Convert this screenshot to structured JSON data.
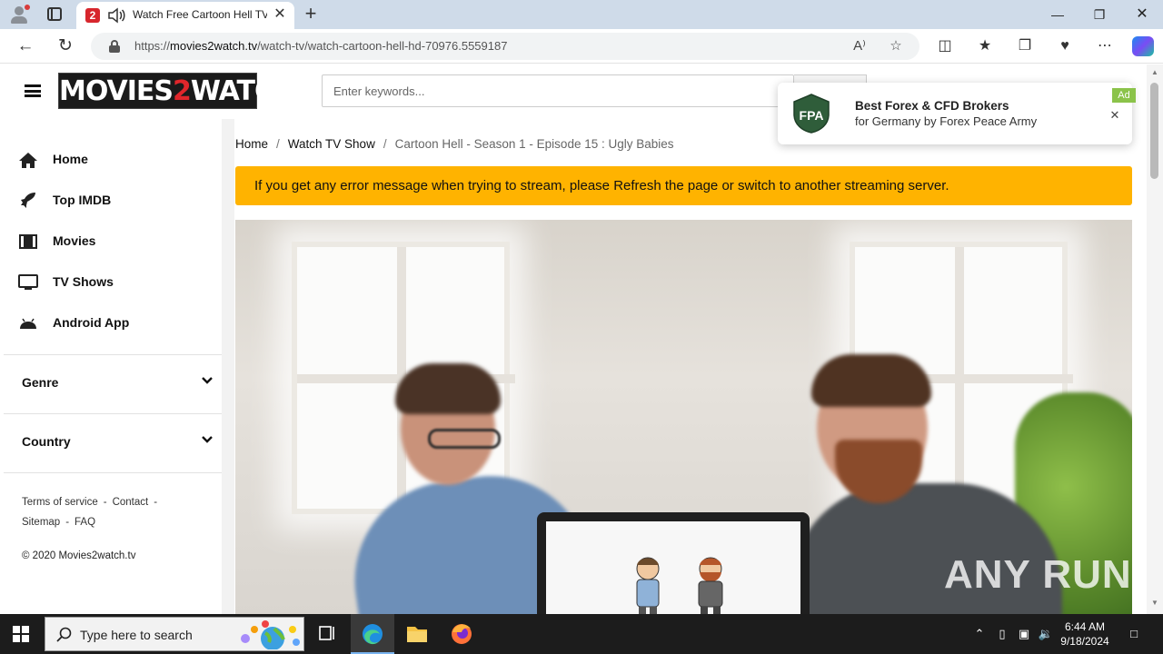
{
  "browser": {
    "tab_title": "Watch Free Cartoon Hell TV",
    "tab_close": "✕",
    "new_tab": "+",
    "url_prefix": "https://",
    "url_domain": "movies2watch.tv",
    "url_path": "/watch-tv/watch-cartoon-hell-hd-70976.5559187",
    "icons": [
      "profile-icon",
      "tab-actions-icon",
      "audio-icon",
      "back-icon",
      "refresh-icon",
      "lock-icon",
      "read-aloud-icon",
      "favorite-star-icon",
      "split-screen-icon",
      "favorites-icon",
      "collections-icon",
      "browser-essentials-icon",
      "more-icon",
      "copilot-icon"
    ]
  },
  "site": {
    "logo_left": "MOVIES",
    "logo_mid": "2",
    "logo_right": "WATCH",
    "search_placeholder": "Enter keywords...",
    "menu": [
      {
        "label": "Home",
        "icon": "home-icon"
      },
      {
        "label": "Top IMDB",
        "icon": "rocket-icon"
      },
      {
        "label": "Movies",
        "icon": "film-icon"
      },
      {
        "label": "TV Shows",
        "icon": "tv-icon"
      },
      {
        "label": "Android App",
        "icon": "android-icon"
      }
    ],
    "dropdowns": [
      "Genre",
      "Country"
    ],
    "footer_links": [
      "Terms of service",
      "Contact",
      "Sitemap",
      "FAQ"
    ],
    "footer_sep": "-",
    "copyright": "© 2020 Movies2watch.tv"
  },
  "breadcrumb": {
    "items": [
      "Home",
      "Watch TV Show",
      "Cartoon Hell - Season 1 - Episode 15 : Ugly Babies"
    ],
    "separator": "/"
  },
  "notice": "If you get any error message when trying to stream, please Refresh the page or switch to another streaming server.",
  "ad": {
    "logo_text": "FPA",
    "title": "Best Forex & CFD Brokers",
    "subtitle": "for Germany by Forex Peace Army",
    "badge": "Ad",
    "close": "✕"
  },
  "watermark": "ANY RUN",
  "taskbar": {
    "search_placeholder": "Type here to search",
    "time": "6:44 AM",
    "date": "9/18/2024"
  },
  "colors": {
    "notice_bg": "#ffb300",
    "logo_accent": "#e0262b",
    "ad_badge": "#8bc34a"
  }
}
